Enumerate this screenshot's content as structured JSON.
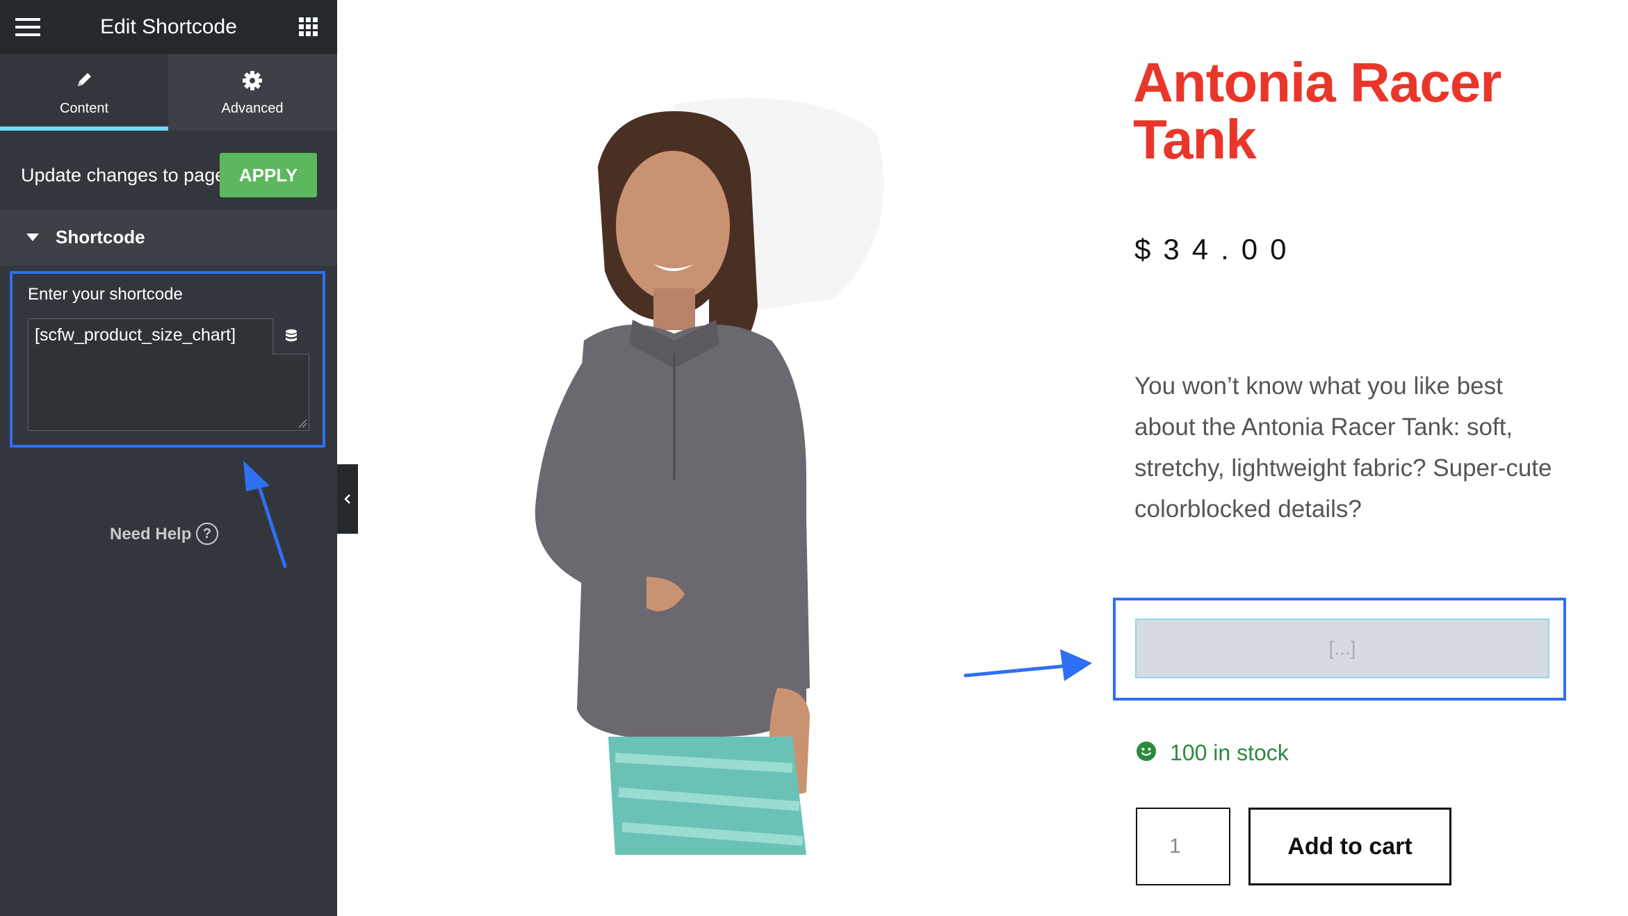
{
  "sidebar": {
    "title": "Edit Shortcode",
    "tabs": [
      {
        "label": "Content",
        "icon": "pencil-icon",
        "active": true
      },
      {
        "label": "Advanced",
        "icon": "gear-icon",
        "active": false
      }
    ],
    "apply_text": "Update changes to page",
    "apply_button": "APPLY",
    "section_title": "Shortcode",
    "field_label": "Enter your shortcode",
    "field_value": "[scfw_product_size_chart]",
    "need_help": "Need Help",
    "help_icon_glyph": "?"
  },
  "product": {
    "title": "Antonia Racer Tank",
    "price": "$34.00",
    "description": "You won’t know what you like best about the Antonia Racer Tank: soft, stretchy, lightweight fabric? Super-cute colorblocked details?",
    "shortcode_placeholder": "[...]",
    "stock": "100 in stock",
    "quantity": "1",
    "add_to_cart": "Add to cart"
  },
  "colors": {
    "accent_blue": "#2f6ff2",
    "apply_green": "#5bb85c",
    "title_red": "#e8372a",
    "stock_green": "#2b8a3e",
    "active_tab_underline": "#71d7f7"
  }
}
